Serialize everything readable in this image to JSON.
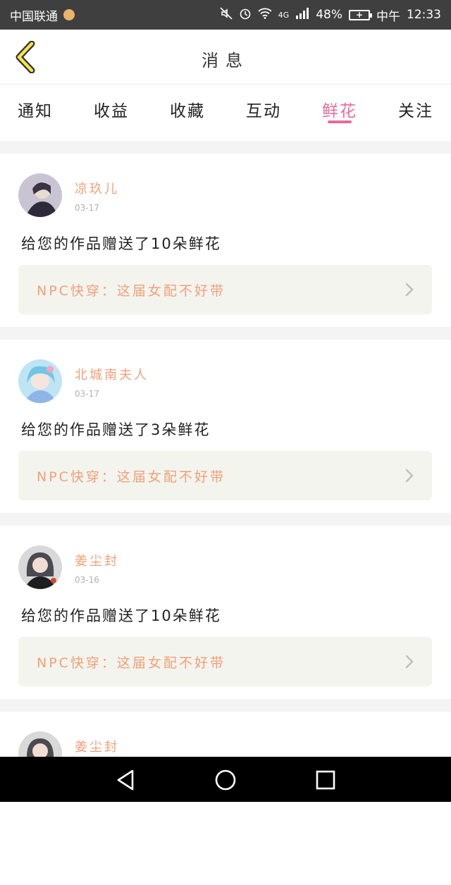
{
  "status_bar": {
    "carrier": "中国联通",
    "battery_percent": "48%",
    "time_period": "中午",
    "time": "12:33",
    "network": "4G"
  },
  "header": {
    "title": "消息"
  },
  "tabs": [
    {
      "label": "通知",
      "active": false
    },
    {
      "label": "收益",
      "active": false
    },
    {
      "label": "收藏",
      "active": false
    },
    {
      "label": "互动",
      "active": false
    },
    {
      "label": "鲜花",
      "active": true
    },
    {
      "label": "关注",
      "active": false
    }
  ],
  "accent_color": "#e86b9a",
  "name_color": "#f0a079",
  "feed": [
    {
      "username": "凉玖儿",
      "date": "03-17",
      "message": "给您的作品赠送了10朵鲜花",
      "work_title": "NPC快穿：这届女配不好带"
    },
    {
      "username": "北城南夫人",
      "date": "03-17",
      "message": "给您的作品赠送了3朵鲜花",
      "work_title": "NPC快穿：这届女配不好带"
    },
    {
      "username": "姜尘封",
      "date": "03-16",
      "message": "给您的作品赠送了10朵鲜花",
      "work_title": "NPC快穿：这届女配不好带"
    },
    {
      "username": "姜尘封",
      "date": "",
      "message": "",
      "work_title": ""
    }
  ]
}
